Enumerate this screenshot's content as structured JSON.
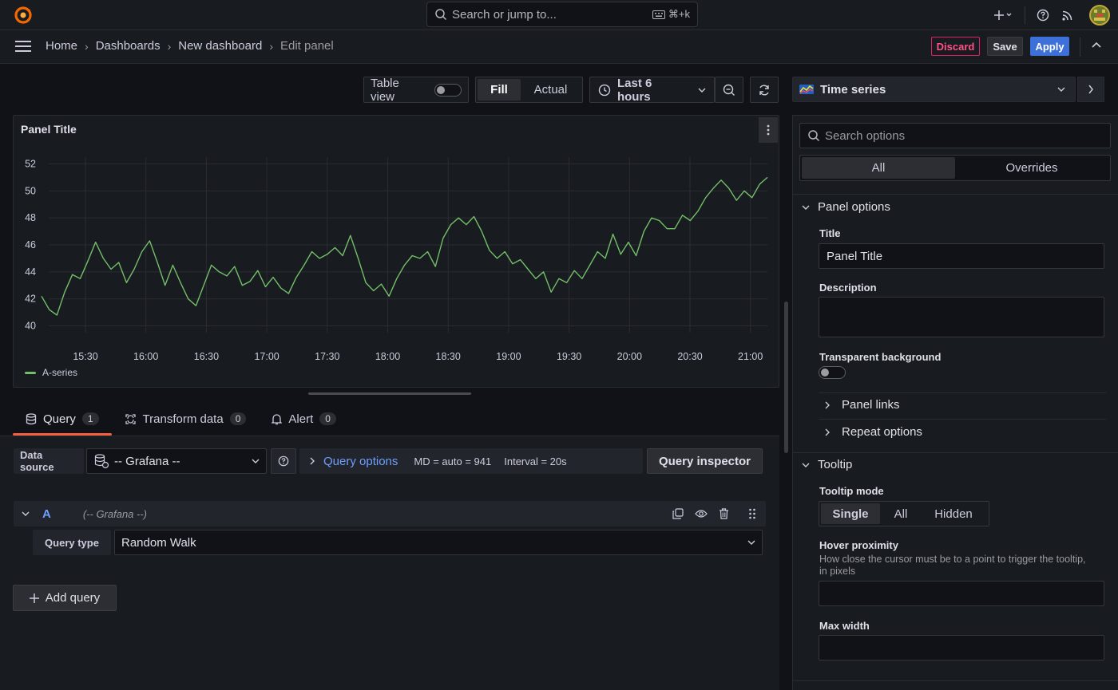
{
  "topbar": {
    "search_placeholder": "Search or jump to...",
    "search_shortcut": "⌘+k"
  },
  "breadcrumbs": [
    "Home",
    "Dashboards",
    "New dashboard",
    "Edit panel"
  ],
  "actions": {
    "discard": "Discard",
    "save": "Save",
    "apply": "Apply"
  },
  "toolbar": {
    "table_view": "Table view",
    "fill": "Fill",
    "actual": "Actual",
    "time_range": "Last 6 hours"
  },
  "panel": {
    "title": "Panel Title",
    "legend_series": "A-series",
    "series_color": "#73bf69"
  },
  "chart_data": {
    "type": "line",
    "x": [
      "15:30",
      "16:00",
      "16:30",
      "17:00",
      "17:30",
      "18:00",
      "18:30",
      "19:00",
      "19:30",
      "20:00",
      "20:30",
      "21:00"
    ],
    "y_ticks": [
      40,
      42,
      44,
      46,
      48,
      50,
      52
    ],
    "ylim": [
      39.5,
      52.5
    ],
    "grid": true,
    "legend": "bottom-left",
    "series": [
      {
        "name": "A-series",
        "values": [
          42.2,
          41.2,
          40.8,
          42.5,
          43.8,
          43.5,
          44.8,
          46.2,
          45.0,
          44.2,
          44.7,
          43.2,
          44.2,
          45.5,
          46.3,
          44.7,
          43.0,
          44.5,
          43.2,
          42.0,
          41.5,
          43.0,
          44.5,
          44.0,
          43.7,
          44.4,
          43.0,
          43.3,
          44.1,
          42.9,
          43.6,
          42.8,
          42.4,
          43.6,
          44.5,
          45.5,
          45.0,
          45.3,
          45.8,
          45.2,
          46.7,
          45.0,
          43.2,
          42.6,
          43.1,
          42.2,
          43.5,
          44.5,
          45.2,
          45.0,
          45.5,
          44.4,
          46.5,
          47.5,
          48.0,
          47.5,
          48.1,
          47.0,
          45.6,
          45.0,
          45.5,
          44.6,
          44.9,
          44.2,
          43.5,
          44.0,
          42.5,
          43.5,
          43.2,
          44.1,
          43.5,
          44.5,
          45.5,
          45.0,
          46.8,
          45.3,
          46.2,
          45.2,
          47.0,
          48.0,
          47.8,
          47.2,
          47.2,
          48.2,
          47.8,
          48.5,
          49.5,
          50.2,
          50.8,
          50.2,
          49.3,
          50.0,
          49.5,
          50.5,
          51.0
        ]
      }
    ]
  },
  "query_tabs": [
    {
      "label": "Query",
      "count": "1"
    },
    {
      "label": "Transform data",
      "count": "0"
    },
    {
      "label": "Alert",
      "count": "0"
    }
  ],
  "query": {
    "data_source_label": "Data source",
    "data_source_value": "-- Grafana --",
    "query_options_label": "Query options",
    "md": "MD = auto = 941",
    "interval": "Interval = 20s",
    "inspector": "Query inspector",
    "row_letter": "A",
    "row_ds": "(-- Grafana --)",
    "query_type_label": "Query type",
    "query_type_value": "Random Walk",
    "add_query": "Add query"
  },
  "options": {
    "viz_name": "Time series",
    "search_placeholder": "Search options",
    "all_tab": "All",
    "overrides_tab": "Overrides",
    "panel_options": "Panel options",
    "title_label": "Title",
    "title_value": "Panel Title",
    "description_label": "Description",
    "transparent_label": "Transparent background",
    "panel_links": "Panel links",
    "repeat_options": "Repeat options",
    "tooltip": "Tooltip",
    "tooltip_mode_label": "Tooltip mode",
    "tooltip_modes": [
      "Single",
      "All",
      "Hidden"
    ],
    "hover_label": "Hover proximity",
    "hover_desc": "How close the cursor must be to a point to trigger the tooltip, in pixels",
    "max_width_label": "Max width"
  }
}
